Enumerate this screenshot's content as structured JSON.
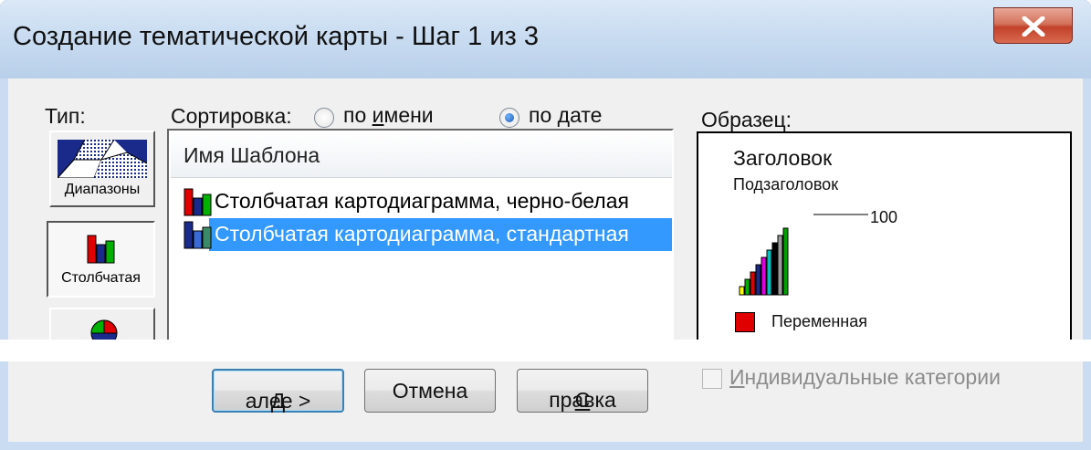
{
  "window": {
    "title": "Создание тематической карты - Шаг 1 из 3",
    "close_icon": "close-x-icon"
  },
  "type_panel": {
    "label": "Тип:",
    "buttons": [
      {
        "label": "Диапазоны",
        "icon": "ranges-map-icon",
        "pressed": false
      },
      {
        "label": "Столбчатая",
        "icon": "bar-chart-icon",
        "pressed": true
      },
      {
        "label": "",
        "icon": "pie-chart-icon",
        "pressed": false
      }
    ]
  },
  "sort": {
    "label": "Сортировка:",
    "by_name": {
      "label": "по именu",
      "text_pre": "по ",
      "text_ul": "и",
      "text_post": "мени",
      "checked": false
    },
    "by_date": {
      "label": "по дате",
      "text_pre": "по ",
      "text_ul": "д",
      "text_post": "ате",
      "checked": true
    }
  },
  "templates": {
    "header": "Имя Шаблона",
    "items": [
      {
        "label": "Столбчатая картодиаграмма, черно-белая",
        "selected": false
      },
      {
        "label": "Столбчатая картодиаграмма, стандартная",
        "selected": true
      }
    ]
  },
  "preview": {
    "label": "Образец:",
    "title": "Заголовок",
    "subtitle": "Подзаголовок",
    "scale_value": "100",
    "legend_label": "Переменная",
    "legend_color": "#e00000"
  },
  "individual_categories": {
    "text_ul": "И",
    "text_post": "ндивидуальные категории",
    "checked": false,
    "enabled": false
  },
  "buttons": {
    "next": {
      "text_ul": "Д",
      "text_post": "алее >"
    },
    "cancel": {
      "label": "Отмена"
    },
    "help": {
      "text_ul": "С",
      "text_post": "правка"
    }
  }
}
